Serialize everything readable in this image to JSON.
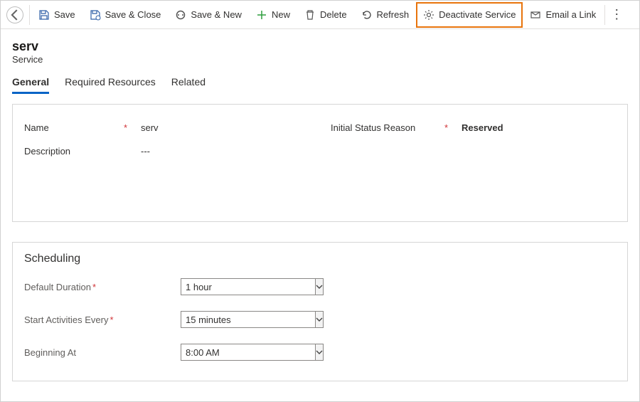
{
  "commandbar": {
    "save": "Save",
    "save_close": "Save & Close",
    "save_new": "Save & New",
    "new": "New",
    "delete": "Delete",
    "refresh": "Refresh",
    "deactivate": "Deactivate Service",
    "email_link": "Email a Link"
  },
  "header": {
    "title": "serv",
    "entity": "Service"
  },
  "tabs": {
    "general": "General",
    "required_resources": "Required Resources",
    "related": "Related"
  },
  "fields": {
    "name_label": "Name",
    "name_value": "serv",
    "status_label": "Initial Status Reason",
    "status_value": "Reserved",
    "description_label": "Description",
    "description_value": "---"
  },
  "scheduling": {
    "title": "Scheduling",
    "default_duration_label": "Default Duration",
    "default_duration_value": "1 hour",
    "start_every_label": "Start Activities Every",
    "start_every_value": "15 minutes",
    "beginning_at_label": "Beginning At",
    "beginning_at_value": "8:00 AM",
    "required_mark": "*"
  }
}
